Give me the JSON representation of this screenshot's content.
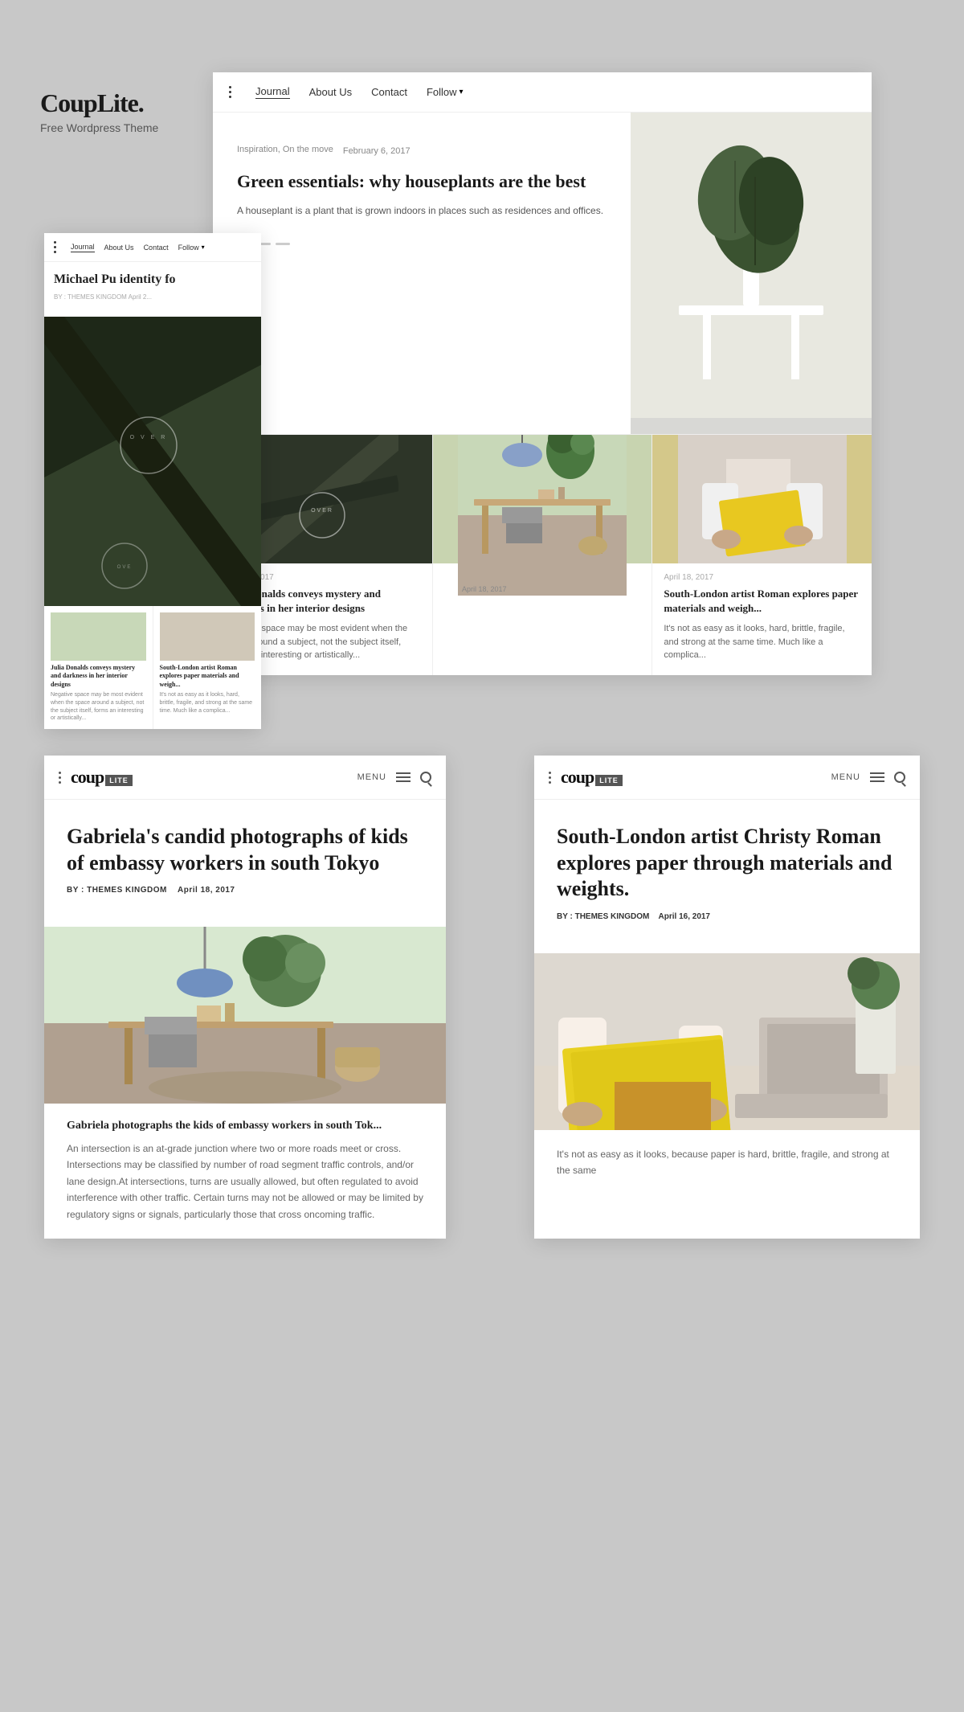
{
  "brand": {
    "name": "CoupLite.",
    "subtitle": "Free Wordpress Theme"
  },
  "nav": {
    "dots_label": "menu",
    "items": [
      {
        "label": "Journal",
        "active": true
      },
      {
        "label": "About Us",
        "active": false
      },
      {
        "label": "Contact",
        "active": false
      },
      {
        "label": "Follow",
        "active": false,
        "has_arrow": true
      }
    ]
  },
  "hero": {
    "category": "Inspiration, On the move",
    "date": "February 6, 2017",
    "title": "Green essentials: why houseplants are the best",
    "description": "A houseplant is a plant that is grown indoors in places such as residences and offices."
  },
  "articles": [
    {
      "date": "April 19, 2017",
      "title": "Julia Donalds conveys mystery and darkness in her interior designs",
      "excerpt": "Negative space may be most evident when the space around a subject, not the subject itself, forms an interesting or artistically..."
    },
    {
      "date": "April 18, 2017",
      "title": "",
      "excerpt": ""
    },
    {
      "date": "April 18, 2017",
      "title": "South-London artist Roman explores paper materials and weigh...",
      "excerpt": "It's not as easy as it looks, hard, brittle, fragile, and strong at the same time. Much like a complica..."
    }
  ],
  "small_mockup": {
    "title": "Michael Pu identity fo",
    "meta": "BY : THEMES KINGDOM    April 2..."
  },
  "bottom_left": {
    "brand": "coup",
    "brand_lite": "LITE",
    "menu_label": "MENU",
    "article": {
      "title": "Gabriela's candid photographs of kids of embassy workers in south Tokyo",
      "meta_by": "BY : THEMES KINGDOM",
      "meta_date": "April 18, 2017",
      "section_title": "Gabriela photographs the kids of embassy workers in south Tok...",
      "section_text": "An intersection is an at-grade junction where two or more roads meet or cross. Intersections may be classified by number of road segment traffic controls, and/or lane design.At intersections, turns are usually allowed, but often regulated to avoid interference with other traffic. Certain turns may not be allowed or may be limited by regulatory signs or signals, particularly those that cross oncoming traffic."
    }
  },
  "bottom_right": {
    "brand": "coup",
    "brand_lite": "LITE",
    "menu_label": "MENU",
    "article": {
      "title": "South-London artist Christy Roman explores paper through materials and weights.",
      "meta_by": "BY : THEMES KINGDOM",
      "meta_date": "April 16, 2017",
      "section_text": "It's not as easy as it looks, because paper is hard, brittle, fragile, and strong at the same"
    }
  },
  "indicators": [
    "active",
    "inactive",
    "inactive"
  ]
}
